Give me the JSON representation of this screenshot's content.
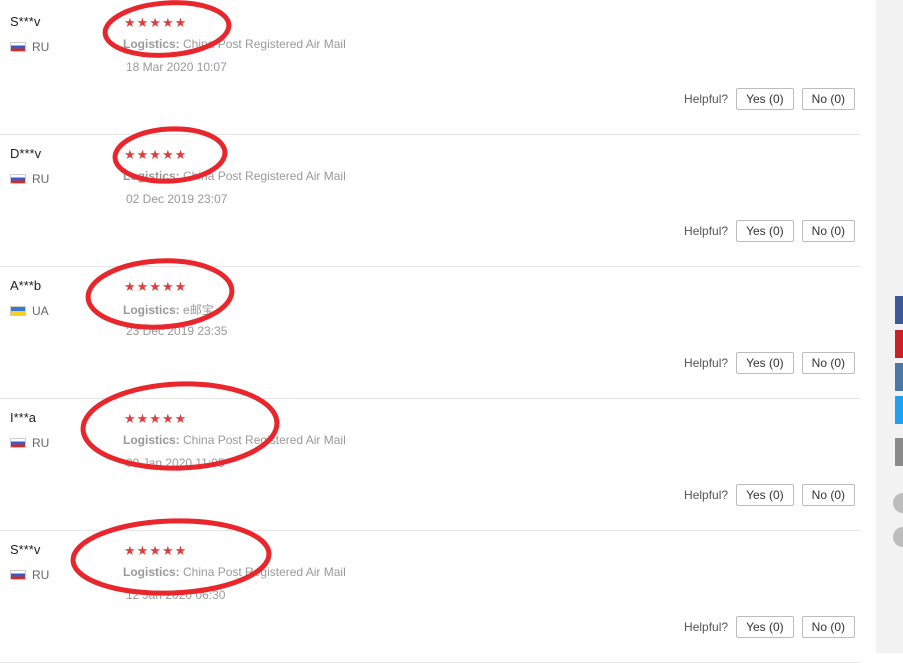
{
  "reviews": [
    {
      "user": "S***v",
      "country": "RU",
      "flag": "ru",
      "stars": "★★★★★",
      "logistics_label": "Logistics:",
      "logistics_value": "China Post Registered Air Mail",
      "date": "18 Mar 2020 10:07",
      "helpful_label": "Helpful?",
      "yes_label": "Yes (0)",
      "no_label": "No (0)"
    },
    {
      "user": "D***v",
      "country": "RU",
      "flag": "ru",
      "stars": "★★★★★",
      "logistics_label": "Logistics:",
      "logistics_value": "China Post Registered Air Mail",
      "date": "02 Dec 2019 23:07",
      "helpful_label": "Helpful?",
      "yes_label": "Yes (0)",
      "no_label": "No (0)"
    },
    {
      "user": "A***b",
      "country": "UA",
      "flag": "ua",
      "stars": "★★★★★",
      "logistics_label": "Logistics:",
      "logistics_value": "e邮宝",
      "date": "23 Dec 2019 23:35",
      "helpful_label": "Helpful?",
      "yes_label": "Yes (0)",
      "no_label": "No (0)"
    },
    {
      "user": "I***a",
      "country": "RU",
      "flag": "ru",
      "stars": "★★★★★",
      "logistics_label": "Logistics:",
      "logistics_value": "China Post Registered Air Mail",
      "date": "09 Jan 2020 11:05",
      "helpful_label": "Helpful?",
      "yes_label": "Yes (0)",
      "no_label": "No (0)"
    },
    {
      "user": "S***v",
      "country": "RU",
      "flag": "ru",
      "stars": "★★★★★",
      "logistics_label": "Logistics:",
      "logistics_value": "China Post Registered Air Mail",
      "date": "12 Jan 2020 06:30",
      "helpful_label": "Helpful?",
      "yes_label": "Yes (0)",
      "no_label": "No (0)"
    }
  ],
  "colors": {
    "star": "#e03e3e",
    "annotation": "#e8262b",
    "share_facebook": "#3b5998",
    "share_pinterest": "#cb2027",
    "share_vk": "#4a76a8",
    "share_twitter": "#1da1f2",
    "share_more": "#8a8a8a"
  },
  "icons": [
    "flag-ru-icon",
    "flag-ua-icon",
    "star-icon",
    "facebook-icon",
    "pinterest-icon",
    "vk-icon",
    "twitter-icon"
  ]
}
